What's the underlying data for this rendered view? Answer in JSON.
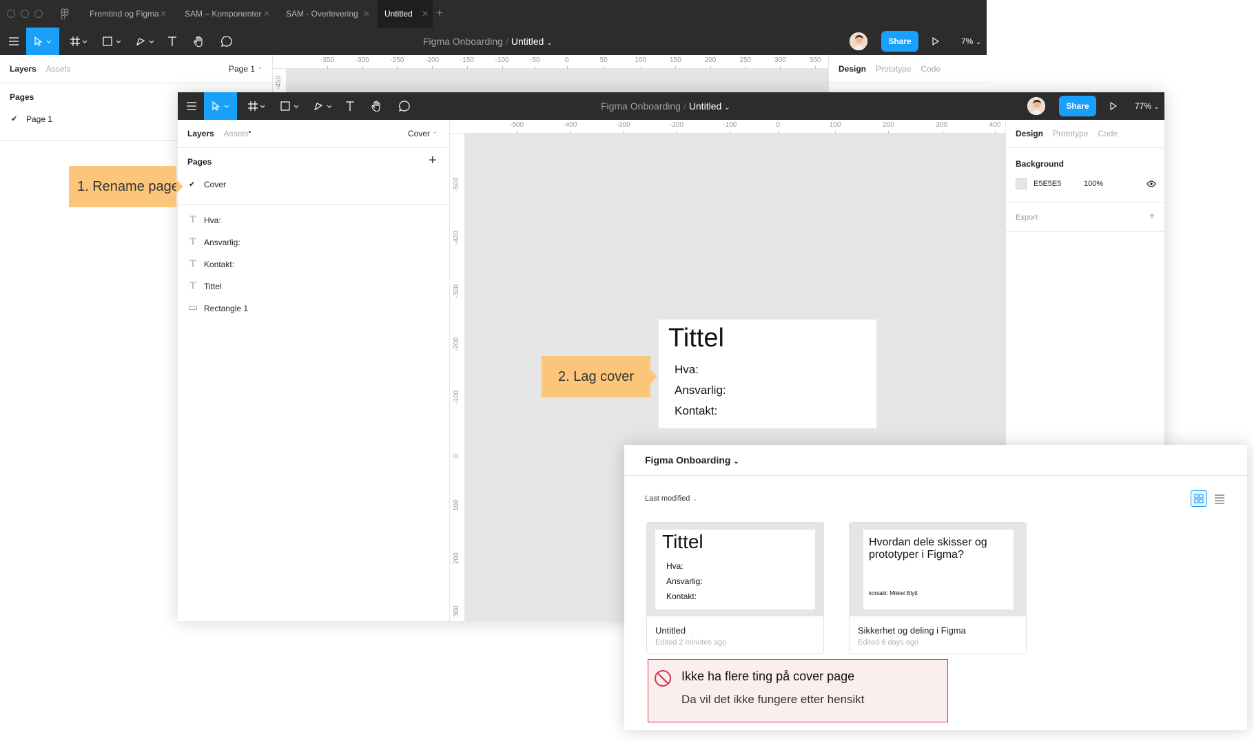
{
  "back_window": {
    "tabs": [
      "Fremtind og Figma",
      "SAM – Komponenter",
      "SAM - Overlevering",
      "Untitled"
    ],
    "title": {
      "project": "Figma Onboarding",
      "file": "Untitled"
    },
    "share_label": "Share",
    "zoom": "7%",
    "left_tabs": {
      "layers": "Layers",
      "assets": "Assets",
      "page": "Page 1"
    },
    "pages_heading": "Pages",
    "pages": [
      "Page 1"
    ],
    "right_tabs": {
      "design": "Design",
      "prototype": "Prototype",
      "code": "Code"
    },
    "ruler_h": [
      "-350",
      "-300",
      "-250",
      "-200",
      "-150",
      "-100",
      "-50",
      "0",
      "50",
      "100",
      "150",
      "200",
      "250",
      "300",
      "350"
    ],
    "ruler_v": [
      "-450"
    ]
  },
  "front_window": {
    "title": {
      "project": "Figma Onboarding",
      "file": "Untitled"
    },
    "share_label": "Share",
    "zoom": "77%",
    "left_tabs": {
      "layers": "Layers",
      "assets": "Assets",
      "page": "Cover"
    },
    "pages_heading": "Pages",
    "pages": [
      "Cover"
    ],
    "layers": [
      {
        "icon": "text",
        "label": "Hva:"
      },
      {
        "icon": "text",
        "label": "Ansvarlig:"
      },
      {
        "icon": "text",
        "label": "Kontakt:"
      },
      {
        "icon": "text",
        "label": "Tittel"
      },
      {
        "icon": "rectangle",
        "label": "Rectangle 1"
      }
    ],
    "right_tabs": {
      "design": "Design",
      "prototype": "Prototype",
      "code": "Code"
    },
    "background_heading": "Background",
    "background_hex": "E5E5E5",
    "background_opacity": "100%",
    "export_heading": "Export",
    "ruler_h": [
      "-500",
      "-400",
      "-300",
      "-200",
      "-100",
      "0",
      "100",
      "200",
      "300",
      "400"
    ],
    "ruler_v": [
      "-500",
      "-400",
      "-300",
      "-200",
      "-100",
      "0",
      "100",
      "200",
      "300"
    ],
    "cover": {
      "title": "Tittel",
      "fields": [
        "Hva:",
        "Ansvarlig:",
        "Kontakt:"
      ]
    }
  },
  "callouts": {
    "rename": "1. Rename page",
    "cover": "2. Lag cover"
  },
  "browser": {
    "project": "Figma Onboarding",
    "sort": "Last modified",
    "files": [
      {
        "name": "Untitled",
        "edited": "Edited 2 minutes ago",
        "thumb_title": "Tittel",
        "thumb_fields": [
          "Hva:",
          "Ansvarlig:",
          "Kontakt:"
        ]
      },
      {
        "name": "Sikkerhet og deling i Figma",
        "edited": "Edited 6 days ago",
        "thumb_title": "Hvordan dele skisser og prototyper i Figma?",
        "thumb_footer": "kontakt: Mikkel Blytt"
      }
    ]
  },
  "warning": {
    "title": "Ikke ha flere ting på cover page",
    "body": "Da vil det ikke fungere etter hensikt"
  },
  "colors": {
    "accent": "#18a0fb",
    "toolbar": "#2c2c2c",
    "canvas": "#e5e5e5",
    "callout": "#fbc67a",
    "warning_border": "#d6334a",
    "warning_bg": "#fbeeee"
  }
}
